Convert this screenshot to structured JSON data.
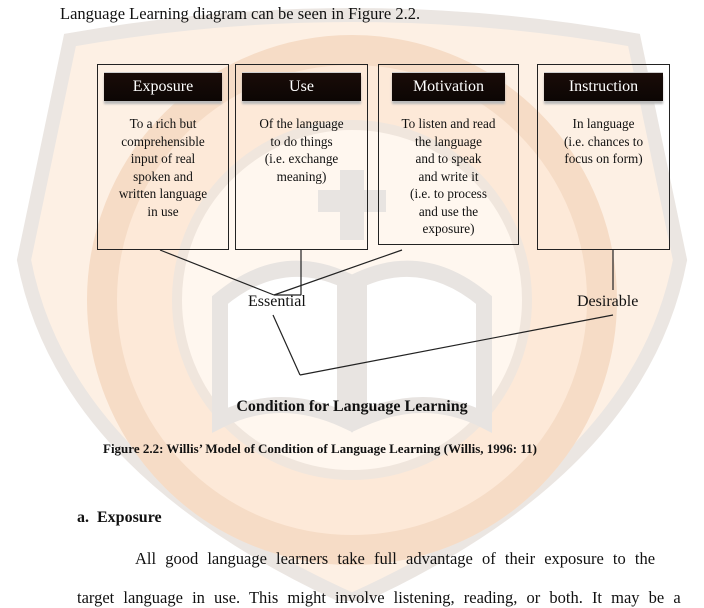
{
  "document": {
    "intro_line": "Language Learning diagram can be seen in Figure 2.2.",
    "diagram": {
      "boxes": [
        {
          "title": "Exposure",
          "text": "To a rich but\ncomprehensible\ninput of real\nspoken and\nwritten language\nin use"
        },
        {
          "title": "Use",
          "text": "Of the language\nto do things\n(i.e. exchange\nmeaning)"
        },
        {
          "title": "Motivation",
          "text": "To listen and read\nthe language\nand to speak\nand write it\n(i.e. to process\nand use the\nexposure)"
        },
        {
          "title": "Instruction",
          "text": "In language\n(i.e. chances to\nfocus on form)"
        }
      ],
      "essential_label": "Essential",
      "desirable_label": "Desirable",
      "diagram_title": "Condition for Language Learning"
    },
    "figure_caption": "Figure 2.2: Willis’ Model of Condition of Language Learning (Willis, 1996: 11)",
    "section_heading": "a.  Exposure",
    "paragraph_line_1": "All good language learners take full advantage of their exposure to the",
    "paragraph_line_2": "target language in use. This might involve listening, reading, or both. It may be a"
  },
  "colors": {
    "header_bg": "#0c0604",
    "watermark_orange": "#fbe3cf",
    "watermark_gray": "#e6e2df"
  }
}
